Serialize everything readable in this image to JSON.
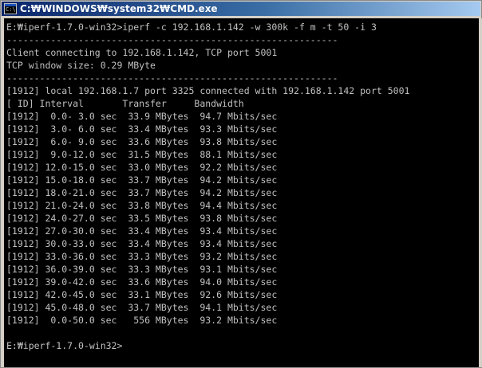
{
  "window": {
    "title": "C:\\WINDOWS\\system32\\CMD.exe",
    "title_display": "C:₩WINDOWS₩system32₩CMD.exe",
    "colors": {
      "console_bg": "#000000",
      "console_text": "#c0c0c0",
      "titlebar": "#0a246a"
    }
  },
  "console": {
    "lines": [
      "E:₩iperf-1.7.0-win32>iperf -c 192.168.1.142 -w 300k -f m -t 50 -i 3",
      "------------------------------------------------------------",
      "Client connecting to 192.168.1.142, TCP port 5001",
      "TCP window size: 0.29 MByte",
      "------------------------------------------------------------",
      "[1912] local 192.168.1.7 port 3325 connected with 192.168.1.142 port 5001",
      "[ ID] Interval       Transfer     Bandwidth",
      "[1912]  0.0- 3.0 sec  33.9 MBytes  94.7 Mbits/sec",
      "[1912]  3.0- 6.0 sec  33.4 MBytes  93.3 Mbits/sec",
      "[1912]  6.0- 9.0 sec  33.6 MBytes  93.8 Mbits/sec",
      "[1912]  9.0-12.0 sec  31.5 MBytes  88.1 Mbits/sec",
      "[1912] 12.0-15.0 sec  33.0 MBytes  92.2 Mbits/sec",
      "[1912] 15.0-18.0 sec  33.7 MBytes  94.2 Mbits/sec",
      "[1912] 18.0-21.0 sec  33.7 MBytes  94.2 Mbits/sec",
      "[1912] 21.0-24.0 sec  33.8 MBytes  94.4 Mbits/sec",
      "[1912] 24.0-27.0 sec  33.5 MBytes  93.8 Mbits/sec",
      "[1912] 27.0-30.0 sec  33.4 MBytes  93.4 Mbits/sec",
      "[1912] 30.0-33.0 sec  33.4 MBytes  93.4 Mbits/sec",
      "[1912] 33.0-36.0 sec  33.3 MBytes  93.2 Mbits/sec",
      "[1912] 36.0-39.0 sec  33.3 MBytes  93.1 Mbits/sec",
      "[1912] 39.0-42.0 sec  33.6 MBytes  94.0 Mbits/sec",
      "[1912] 42.0-45.0 sec  33.1 MBytes  92.6 Mbits/sec",
      "[1912] 45.0-48.0 sec  33.7 MBytes  94.1 Mbits/sec",
      "[1912]  0.0-50.0 sec   556 MBytes  93.2 Mbits/sec",
      "",
      "E:₩iperf-1.7.0-win32>"
    ]
  }
}
